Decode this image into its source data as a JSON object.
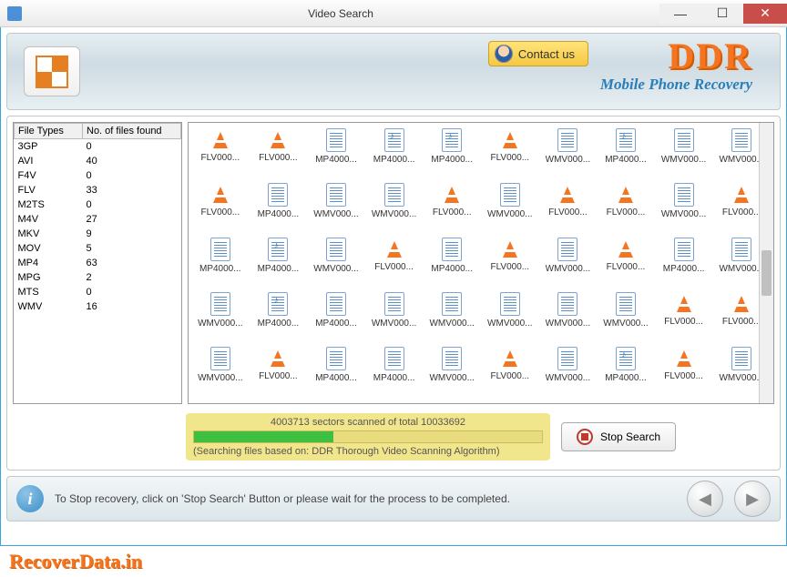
{
  "titlebar": {
    "title": "Video Search"
  },
  "header": {
    "contact_label": "Contact us",
    "brand": "DDR",
    "brand_sub": "Mobile Phone Recovery"
  },
  "filetypes": {
    "col1": "File Types",
    "col2": "No. of files found",
    "rows": [
      {
        "type": "3GP",
        "count": "0"
      },
      {
        "type": "AVI",
        "count": "40"
      },
      {
        "type": "F4V",
        "count": "0"
      },
      {
        "type": "FLV",
        "count": "33"
      },
      {
        "type": "M2TS",
        "count": "0"
      },
      {
        "type": "M4V",
        "count": "27"
      },
      {
        "type": "MKV",
        "count": "9"
      },
      {
        "type": "MOV",
        "count": "5"
      },
      {
        "type": "MP4",
        "count": "63"
      },
      {
        "type": "MPG",
        "count": "2"
      },
      {
        "type": "MTS",
        "count": "0"
      },
      {
        "type": "WMV",
        "count": "16"
      }
    ]
  },
  "files": [
    {
      "name": "FLV000...",
      "icon": "cone"
    },
    {
      "name": "FLV000...",
      "icon": "cone"
    },
    {
      "name": "MP4000...",
      "icon": "doc"
    },
    {
      "name": "MP4000...",
      "icon": "music"
    },
    {
      "name": "MP4000...",
      "icon": "music"
    },
    {
      "name": "FLV000...",
      "icon": "cone"
    },
    {
      "name": "WMV000...",
      "icon": "doc"
    },
    {
      "name": "MP4000...",
      "icon": "music"
    },
    {
      "name": "WMV000...",
      "icon": "doc"
    },
    {
      "name": "WMV000...",
      "icon": "doc"
    },
    {
      "name": "FLV000...",
      "icon": "cone"
    },
    {
      "name": "MP4000...",
      "icon": "doc"
    },
    {
      "name": "WMV000...",
      "icon": "doc"
    },
    {
      "name": "WMV000...",
      "icon": "doc"
    },
    {
      "name": "FLV000...",
      "icon": "cone"
    },
    {
      "name": "WMV000...",
      "icon": "doc"
    },
    {
      "name": "FLV000...",
      "icon": "cone"
    },
    {
      "name": "FLV000...",
      "icon": "cone"
    },
    {
      "name": "WMV000...",
      "icon": "doc"
    },
    {
      "name": "FLV000...",
      "icon": "cone"
    },
    {
      "name": "MP4000...",
      "icon": "doc"
    },
    {
      "name": "MP4000...",
      "icon": "music"
    },
    {
      "name": "WMV000...",
      "icon": "doc"
    },
    {
      "name": "FLV000...",
      "icon": "cone"
    },
    {
      "name": "MP4000...",
      "icon": "doc"
    },
    {
      "name": "FLV000...",
      "icon": "cone"
    },
    {
      "name": "WMV000...",
      "icon": "doc"
    },
    {
      "name": "FLV000...",
      "icon": "cone"
    },
    {
      "name": "MP4000...",
      "icon": "doc"
    },
    {
      "name": "WMV000...",
      "icon": "doc"
    },
    {
      "name": "WMV000...",
      "icon": "doc"
    },
    {
      "name": "MP4000...",
      "icon": "music"
    },
    {
      "name": "MP4000...",
      "icon": "doc"
    },
    {
      "name": "WMV000...",
      "icon": "doc"
    },
    {
      "name": "WMV000...",
      "icon": "doc"
    },
    {
      "name": "WMV000...",
      "icon": "doc"
    },
    {
      "name": "WMV000...",
      "icon": "doc"
    },
    {
      "name": "WMV000...",
      "icon": "doc"
    },
    {
      "name": "FLV000...",
      "icon": "cone"
    },
    {
      "name": "FLV000...",
      "icon": "cone"
    },
    {
      "name": "WMV000...",
      "icon": "doc"
    },
    {
      "name": "FLV000...",
      "icon": "cone"
    },
    {
      "name": "MP4000...",
      "icon": "doc"
    },
    {
      "name": "MP4000...",
      "icon": "doc"
    },
    {
      "name": "WMV000...",
      "icon": "doc"
    },
    {
      "name": "FLV000...",
      "icon": "cone"
    },
    {
      "name": "WMV000...",
      "icon": "doc"
    },
    {
      "name": "MP4000...",
      "icon": "music"
    },
    {
      "name": "FLV000...",
      "icon": "cone"
    },
    {
      "name": "WMV000...",
      "icon": "doc"
    }
  ],
  "progress": {
    "text": "4003713 sectors scanned of total 10033692",
    "percent": 40,
    "sub": "(Searching files based on:  DDR Thorough Video Scanning Algorithm)",
    "stop_label": "Stop Search"
  },
  "footer": {
    "text": "To Stop recovery, click on 'Stop Search' Button or please wait for the process to be completed."
  },
  "watermark": "RecoverData.in"
}
